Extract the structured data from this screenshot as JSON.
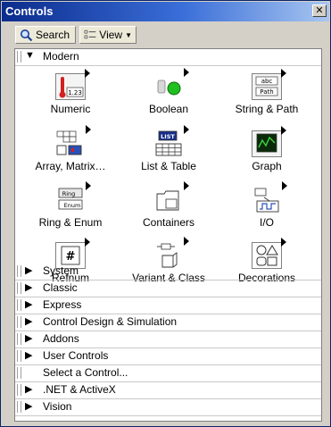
{
  "window": {
    "title": "Controls",
    "close_label": "✕"
  },
  "toolbar": {
    "search_label": "Search",
    "view_label": "View"
  },
  "modern": {
    "label": "Modern",
    "items": [
      {
        "label": "Numeric",
        "icon": "numeric-icon"
      },
      {
        "label": "Boolean",
        "icon": "boolean-icon"
      },
      {
        "label": "String & Path",
        "icon": "string-path-icon"
      },
      {
        "label": "Array, Matrix…",
        "icon": "array-matrix-icon"
      },
      {
        "label": "List & Table",
        "icon": "list-table-icon"
      },
      {
        "label": "Graph",
        "icon": "graph-icon"
      },
      {
        "label": "Ring & Enum",
        "icon": "ring-enum-icon"
      },
      {
        "label": "Containers",
        "icon": "containers-icon"
      },
      {
        "label": "I/O",
        "icon": "io-icon"
      },
      {
        "label": "Refnum",
        "icon": "refnum-icon"
      },
      {
        "label": "Variant & Class",
        "icon": "variant-class-icon"
      },
      {
        "label": "Decorations",
        "icon": "decorations-icon"
      }
    ],
    "icon_text": {
      "numeric": "1.23",
      "string1": "abc",
      "string2": "Path",
      "list": "LIST",
      "ring": "Ring",
      "enum": "Enum",
      "refnum": "#"
    }
  },
  "categories": [
    {
      "label": "System",
      "expandable": true
    },
    {
      "label": "Classic",
      "expandable": true
    },
    {
      "label": "Express",
      "expandable": true
    },
    {
      "label": "Control Design & Simulation",
      "expandable": true
    },
    {
      "label": "Addons",
      "expandable": true
    },
    {
      "label": "User Controls",
      "expandable": true
    },
    {
      "label": "Select a Control...",
      "expandable": false
    },
    {
      "label": ".NET & ActiveX",
      "expandable": true
    },
    {
      "label": "Vision",
      "expandable": true
    }
  ],
  "colors": {
    "title_start": "#0b2c8c",
    "title_end": "#a8c6f0",
    "boolean_green": "#1fc01f",
    "numeric_red": "#d42020"
  }
}
